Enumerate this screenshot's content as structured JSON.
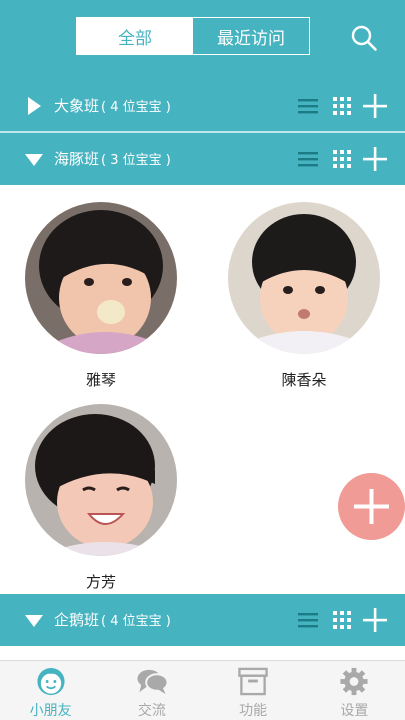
{
  "tabs": {
    "all": "全部",
    "recent": "最近访问"
  },
  "groups": [
    {
      "name": "大象班",
      "count": "( 4 位宝宝 )",
      "expanded": false
    },
    {
      "name": "海豚班",
      "count": "( 3 位宝宝 )",
      "expanded": true
    },
    {
      "name": "企鹅班",
      "count": "( 4 位宝宝 )",
      "expanded": true
    }
  ],
  "children": [
    {
      "name": "雅琴"
    },
    {
      "name": "陳香朵"
    },
    {
      "name": "方芳"
    }
  ],
  "nav": [
    {
      "label": "小朋友",
      "icon": "baby-face-icon",
      "active": true
    },
    {
      "label": "交流",
      "icon": "chat-bubbles-icon",
      "active": false
    },
    {
      "label": "功能",
      "icon": "archive-box-icon",
      "active": false
    },
    {
      "label": "设置",
      "icon": "gear-icon",
      "active": false
    }
  ],
  "colors": {
    "accent": "#46b3c1",
    "fab": "#f19b96",
    "inactive": "#a9a9a9"
  }
}
